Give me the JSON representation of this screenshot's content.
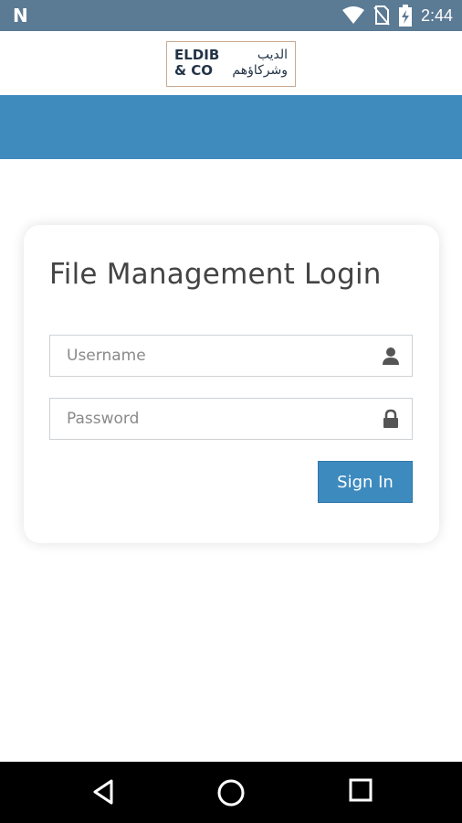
{
  "status_bar": {
    "time": "2:44",
    "icons": [
      "n-notification-icon",
      "wifi-icon",
      "no-sim-icon",
      "battery-charging-icon"
    ]
  },
  "header": {
    "logo_en_line1": "ELDIB",
    "logo_en_line2": "& CO",
    "logo_ar_line1": "الديب",
    "logo_ar_line2": "وشركاؤهم"
  },
  "login": {
    "title": "File Management Login",
    "username_placeholder": "Username",
    "username_value": "",
    "password_placeholder": "Password",
    "password_value": "",
    "sign_in_label": "Sign In"
  },
  "nav_bar": {
    "buttons": [
      "back-icon",
      "home-icon",
      "recents-icon"
    ]
  },
  "colors": {
    "status_bar": "#5b7a94",
    "header_band": "#3f8bbd",
    "button": "#3d8abf"
  }
}
